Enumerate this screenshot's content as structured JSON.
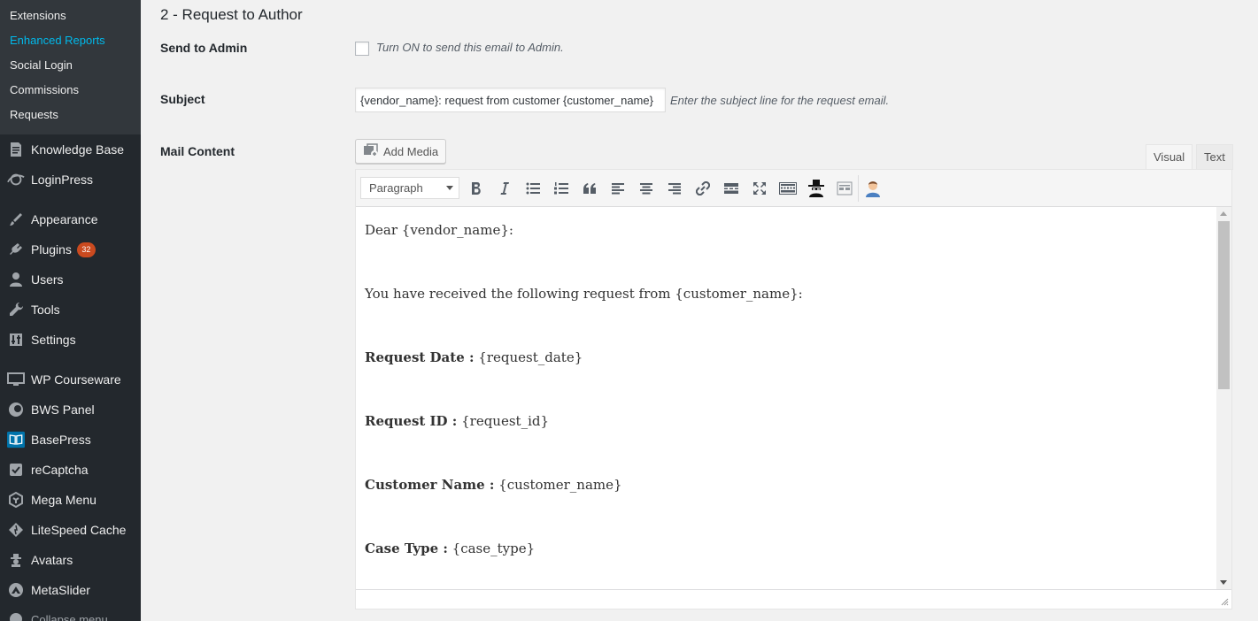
{
  "sidebar": {
    "submenu": [
      "Extensions",
      "Enhanced Reports",
      "Social Login",
      "Commissions",
      "Requests"
    ],
    "current_submenu": "Enhanced Reports",
    "menu": [
      {
        "label": "Knowledge Base",
        "icon": "document-icon"
      },
      {
        "label": "LoginPress",
        "icon": "loginpress-icon"
      },
      {
        "label": "Appearance",
        "icon": "paintbrush-icon"
      },
      {
        "label": "Plugins",
        "icon": "plugin-icon",
        "badge": "32"
      },
      {
        "label": "Users",
        "icon": "user-icon"
      },
      {
        "label": "Tools",
        "icon": "wrench-icon"
      },
      {
        "label": "Settings",
        "icon": "settings-icon"
      },
      {
        "label": "WP Courseware",
        "icon": "monitor-icon"
      },
      {
        "label": "BWS Panel",
        "icon": "bws-icon"
      },
      {
        "label": "BasePress",
        "icon": "book-icon"
      },
      {
        "label": "reCaptcha",
        "icon": "check-icon"
      },
      {
        "label": "Mega Menu",
        "icon": "megamenu-icon"
      },
      {
        "label": "LiteSpeed Cache",
        "icon": "diamond-icon"
      },
      {
        "label": "Avatars",
        "icon": "avatar-icon"
      },
      {
        "label": "MetaSlider",
        "icon": "metaslider-icon"
      }
    ],
    "collapse_label": "Collapse menu"
  },
  "main": {
    "section_title": "2 - Request to Author",
    "send_to_admin": {
      "label": "Send to Admin",
      "description": "Turn ON to send this email to Admin.",
      "checked": false
    },
    "subject": {
      "label": "Subject",
      "value": "{vendor_name}: request from customer {customer_name}",
      "description": "Enter the subject line for the request email."
    },
    "mail_content": {
      "label": "Mail Content",
      "add_media_label": "Add Media",
      "tabs": [
        "Visual",
        "Text"
      ],
      "active_tab": "Visual",
      "format_value": "Paragraph",
      "toolbar_icons": [
        "bold-icon",
        "italic-icon",
        "bullet-list-icon",
        "numbered-list-icon",
        "blockquote-icon",
        "align-left-icon",
        "align-center-icon",
        "align-right-icon",
        "link-icon",
        "read-more-icon",
        "fullscreen-icon",
        "toolbar-toggle-icon",
        "spy-icon",
        "shortcode-icon",
        "avatar-shortcode-icon"
      ],
      "body": {
        "greeting": "Dear {vendor_name}:",
        "intro": "You have received the following request from {customer_name}:",
        "fields": [
          {
            "label": "Request Date :",
            "value": "{request_date}"
          },
          {
            "label": "Request ID :",
            "value": "{request_id}"
          },
          {
            "label": "Customer Name :",
            "value": "{customer_name}"
          },
          {
            "label": "Case Type :",
            "value": "{case_type}"
          }
        ]
      }
    }
  },
  "colors": {
    "sidebar_bg": "#23282d",
    "submenu_bg": "#32373c",
    "current_link": "#00b9eb",
    "badge": "#ca4a1f",
    "page_bg": "#f1f1f1"
  }
}
